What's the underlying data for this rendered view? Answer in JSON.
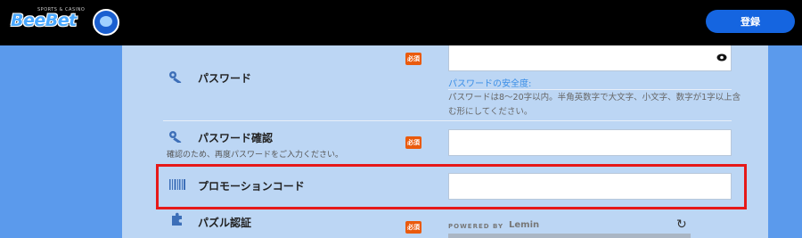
{
  "header": {
    "logo_text": "BeeBet",
    "logo_tagline": "SPORTS & CASINO",
    "register_label": "登録"
  },
  "form": {
    "required_label": "必須",
    "password": {
      "label": "パスワード",
      "strength_label": "パスワードの安全度:",
      "hint": "パスワードは8〜20字以内。半角英数字で大文字、小文字、数字が1字以上含む形にしてください。"
    },
    "password_confirm": {
      "label": "パスワード確認",
      "note": "確認のため、再度パスワードをご入力ください。"
    },
    "promo": {
      "label": "プロモーションコード"
    },
    "puzzle": {
      "label": "パズル認証",
      "powered_by": "POWERED BY",
      "provider": "Lemin"
    }
  },
  "colors": {
    "header_bg": "#000000",
    "page_bg": "#5b9aec",
    "panel_bg": "#bcd6f4",
    "accent": "#1565e0",
    "required_badge": "#ea5a0c",
    "highlight_border": "#e61919"
  },
  "icons": [
    "key-icon",
    "eye-icon",
    "barcode-icon",
    "puzzle-icon",
    "refresh-icon"
  ]
}
